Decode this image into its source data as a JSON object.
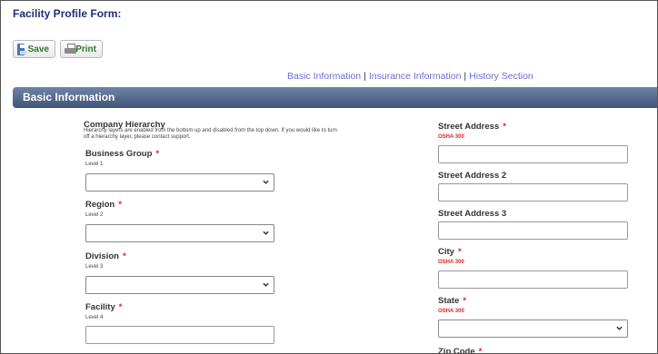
{
  "page": {
    "title": "Facility Profile Form:"
  },
  "toolbar": {
    "save_label": "Save",
    "print_label": "Print"
  },
  "anchors": {
    "basic": "Basic Information",
    "insurance": "Insurance Information",
    "history": "History Section",
    "separator": "|"
  },
  "section": {
    "title": "Basic Information"
  },
  "hierarchy": {
    "title": "Company Hierarchy",
    "help": "Hierarchy layers are enabled from the bottom up and disabled from the top down. If you would like to turn off a hierarchy layer, please contact support.",
    "required_marker": "*",
    "business_group": {
      "label": "Business Group",
      "level": "Level 1",
      "value": ""
    },
    "region": {
      "label": "Region",
      "level": "Level 2",
      "value": ""
    },
    "division": {
      "label": "Division",
      "level": "Level 3",
      "value": ""
    },
    "facility": {
      "label": "Facility",
      "level": "Level 4",
      "value": ""
    }
  },
  "address": {
    "street1": {
      "label": "Street Address",
      "note": "OSHA 300",
      "value": ""
    },
    "street2": {
      "label": "Street Address 2",
      "value": ""
    },
    "street3": {
      "label": "Street Address 3",
      "value": ""
    },
    "city": {
      "label": "City",
      "note": "OSHA 300",
      "value": ""
    },
    "state": {
      "label": "State",
      "note": "OSHA 300",
      "value": ""
    },
    "zip": {
      "label": "Zip Code"
    }
  },
  "colors": {
    "title": "#1f2d7a",
    "section_bar": "#4a5f82",
    "link": "#6b6bd6",
    "required": "#dd2222",
    "button_text": "#2f7a2f"
  },
  "icons": {
    "save": "floppy-disk-icon",
    "print": "printer-icon",
    "select": "chevron-down-icon"
  }
}
